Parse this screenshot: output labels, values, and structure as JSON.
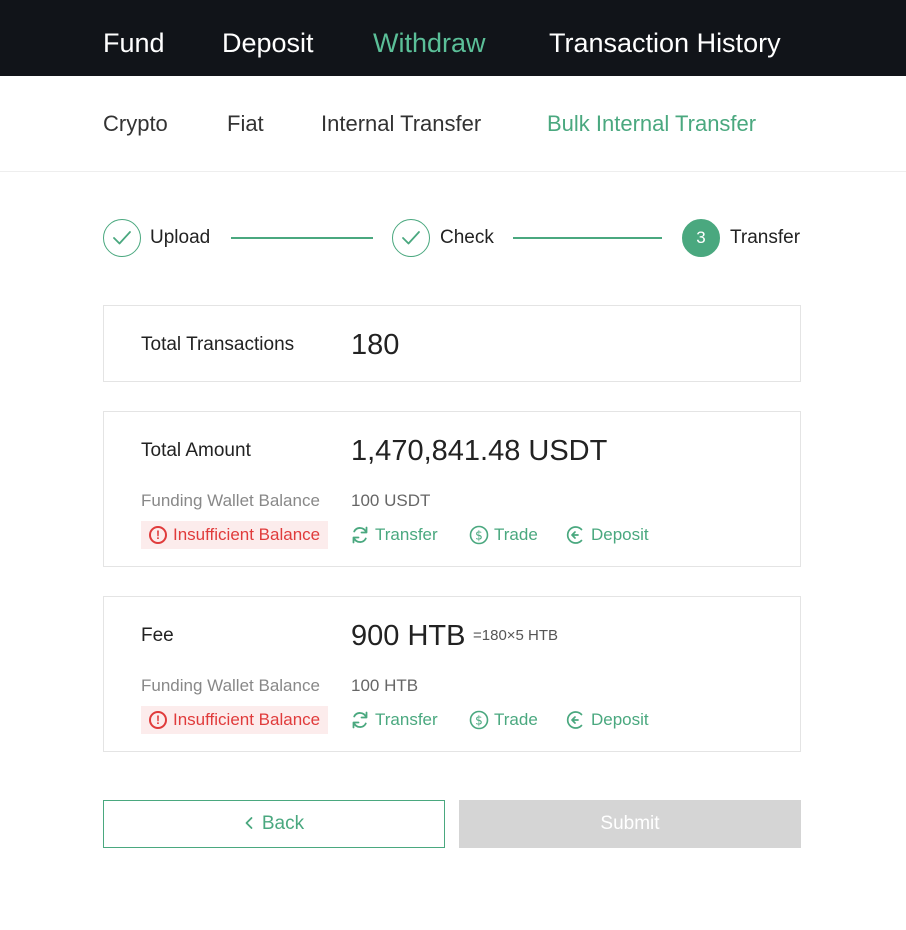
{
  "top_nav": {
    "items": [
      {
        "label": "Fund"
      },
      {
        "label": "Deposit"
      },
      {
        "label": "Withdraw"
      },
      {
        "label": "Transaction History"
      }
    ],
    "active_index": 2
  },
  "sub_nav": {
    "items": [
      {
        "label": "Crypto"
      },
      {
        "label": "Fiat"
      },
      {
        "label": "Internal Transfer"
      },
      {
        "label": "Bulk Internal Transfer"
      }
    ],
    "active_index": 3
  },
  "steps": [
    {
      "label": "Upload",
      "state": "done"
    },
    {
      "label": "Check",
      "state": "done"
    },
    {
      "label": "Transfer",
      "number": "3",
      "state": "current"
    }
  ],
  "total_transactions": {
    "label": "Total Transactions",
    "value": "180"
  },
  "total_amount": {
    "label": "Total Amount",
    "value": "1,470,841.48 USDT",
    "balance_label": "Funding Wallet Balance",
    "balance_value": "100 USDT",
    "warning": "Insufficient Balance",
    "actions": {
      "transfer": "Transfer",
      "trade": "Trade",
      "deposit": "Deposit"
    }
  },
  "fee": {
    "label": "Fee",
    "value": "900 HTB",
    "formula": "=180×5 HTB",
    "balance_label": "Funding Wallet Balance",
    "balance_value": "100 HTB",
    "warning": "Insufficient Balance",
    "actions": {
      "transfer": "Transfer",
      "trade": "Trade",
      "deposit": "Deposit"
    }
  },
  "buttons": {
    "back": "Back",
    "submit": "Submit"
  },
  "colors": {
    "accent": "#4aa87f",
    "nav_bg": "#111419",
    "error": "#e03b3b",
    "disabled": "#d5d5d5"
  },
  "icons": {
    "step_done": "check-icon",
    "warning": "exclamation-circle-icon",
    "transfer": "refresh-icon",
    "trade": "dollar-circle-icon",
    "deposit": "arrow-left-circle-icon",
    "back": "chevron-left-icon"
  }
}
